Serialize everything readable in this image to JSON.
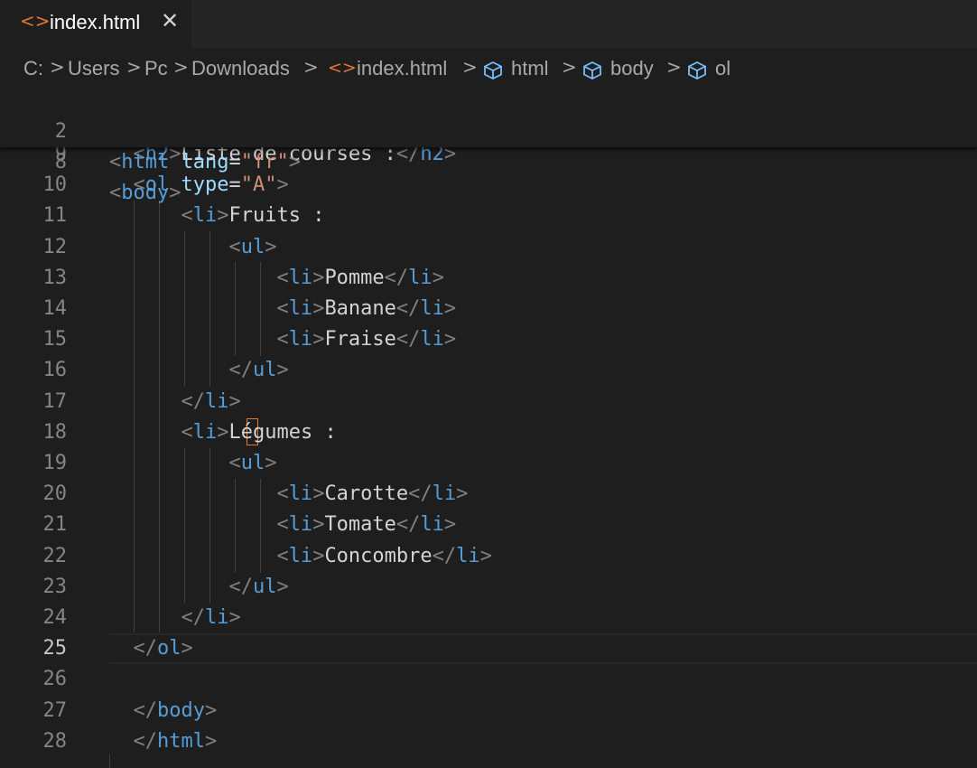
{
  "tab": {
    "icon": "<>",
    "label": "index.html",
    "close": "✕"
  },
  "breadcrumb": {
    "sep": ">",
    "items": [
      "C:",
      "Users",
      "Pc",
      "Downloads",
      "index.html",
      "html",
      "body",
      "ol"
    ]
  },
  "sticky": [
    {
      "n": "2",
      "t": "<html lang=\"fr\">"
    },
    {
      "n": "8",
      "t": "<body>"
    }
  ],
  "editor": {
    "active_line": "25",
    "lines": [
      {
        "n": "9",
        "t": "  <h2>Liste de courses :</h2>"
      },
      {
        "n": "10",
        "t": "  <ol type=\"A\">"
      },
      {
        "n": "11",
        "t": "      <li>Fruits :"
      },
      {
        "n": "12",
        "t": "          <ul>"
      },
      {
        "n": "13",
        "t": "              <li>Pomme</li>"
      },
      {
        "n": "14",
        "t": "              <li>Banane</li>"
      },
      {
        "n": "15",
        "t": "              <li>Fraise</li>"
      },
      {
        "n": "16",
        "t": "          </ul>"
      },
      {
        "n": "17",
        "t": "      </li>"
      },
      {
        "n": "18",
        "t": "      <li>Légumes :"
      },
      {
        "n": "19",
        "t": "          <ul>"
      },
      {
        "n": "20",
        "t": "              <li>Carotte</li>"
      },
      {
        "n": "21",
        "t": "              <li>Tomate</li>"
      },
      {
        "n": "22",
        "t": "              <li>Concombre</li>"
      },
      {
        "n": "23",
        "t": "          </ul>"
      },
      {
        "n": "24",
        "t": "      </li>"
      },
      {
        "n": "25",
        "t": "  </ol>"
      },
      {
        "n": "26",
        "t": ""
      },
      {
        "n": "27",
        "t": "  </body>"
      },
      {
        "n": "28",
        "t": "  </html>"
      }
    ]
  },
  "colors": {
    "tag": "#569cd6",
    "attr": "#9cdcfe",
    "string": "#ce9178",
    "bracket": "#808080",
    "text": "#d4d4d4",
    "cursor": "#e37933"
  }
}
